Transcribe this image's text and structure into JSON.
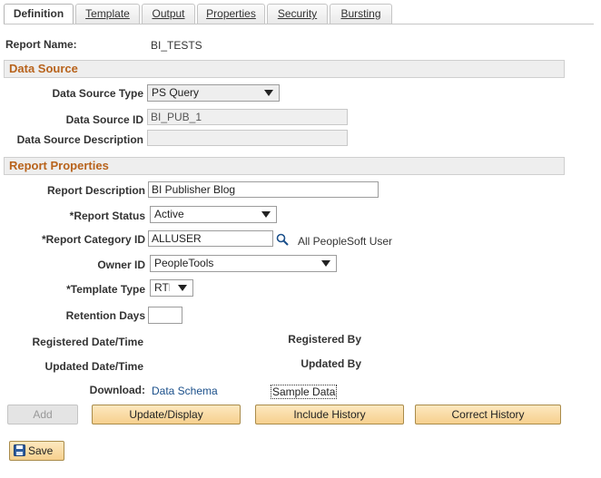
{
  "tabs": [
    {
      "label": "Definition"
    },
    {
      "label": "Template"
    },
    {
      "label": "Output"
    },
    {
      "label": "Properties"
    },
    {
      "label": "Security"
    },
    {
      "label": "Bursting"
    }
  ],
  "report_name": {
    "label": "Report Name:",
    "value": "BI_TESTS"
  },
  "data_source": {
    "section_title": "Data Source",
    "type_label": "Data Source Type",
    "type_value": "PS Query",
    "id_label": "Data Source ID",
    "id_value": "BI_PUB_1",
    "description_label": "Data Source Description",
    "description_value": ""
  },
  "report_properties": {
    "section_title": "Report Properties",
    "description_label": "Report Description",
    "description_value": "BI Publisher Blog",
    "status_label": "*Report Status",
    "status_value": "Active",
    "category_label": "*Report Category ID",
    "category_value": "ALLUSER",
    "category_desc": "All PeopleSoft User",
    "owner_label": "Owner ID",
    "owner_value": "PeopleTools",
    "template_type_label": "*Template Type",
    "template_type_value": "RTF",
    "retention_label": "Retention Days",
    "retention_value": "",
    "registered_dt_label": "Registered Date/Time",
    "registered_by_label": "Registered By",
    "updated_dt_label": "Updated Date/Time",
    "updated_by_label": "Updated By",
    "download_label": "Download:",
    "data_schema_link": "Data Schema",
    "sample_data_link": "Sample Data"
  },
  "buttons": {
    "add": "Add",
    "update_display": "Update/Display",
    "include_history": "Include History",
    "correct_history": "Correct History",
    "save": "Save"
  },
  "colors": {
    "section_title": "#b8631c",
    "link": "#1a4f8a",
    "button": "#f6d08e"
  }
}
